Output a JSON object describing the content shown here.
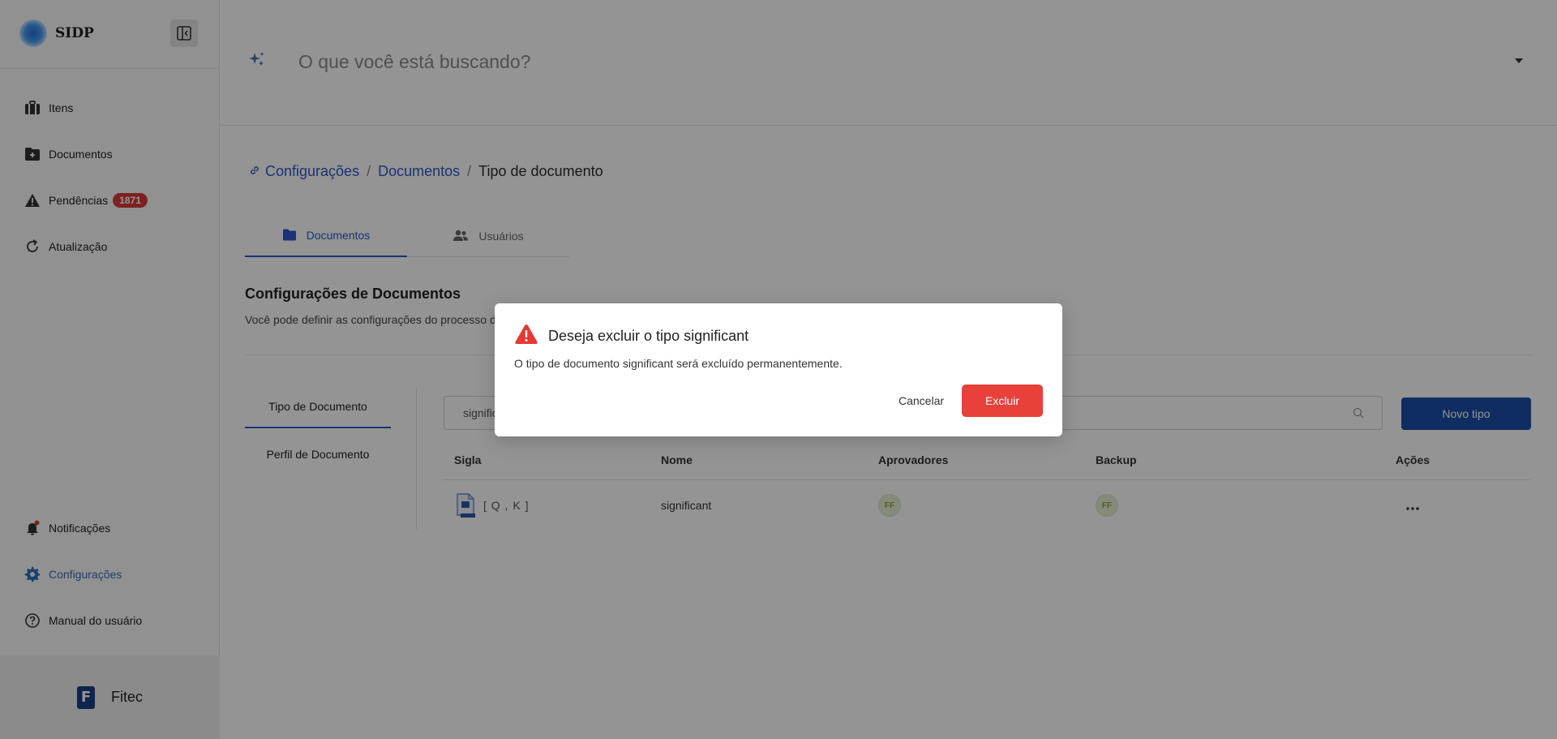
{
  "app": {
    "name": "SIDP"
  },
  "sidebar": {
    "items": [
      {
        "label": "Itens",
        "icon": "briefcase-icon"
      },
      {
        "label": "Documentos",
        "icon": "folder-plus-icon"
      },
      {
        "label": "Pendências",
        "icon": "warning-icon",
        "badge": "1871"
      },
      {
        "label": "Atualização",
        "icon": "refresh-icon"
      }
    ],
    "bottom_items": [
      {
        "label": "Notificações",
        "icon": "bell-icon"
      },
      {
        "label": "Configurações",
        "icon": "gear-icon",
        "active": true
      },
      {
        "label": "Manual do usuário",
        "icon": "help-circle-icon"
      }
    ],
    "footer": {
      "logo_letter": "F",
      "name": "Fitec"
    }
  },
  "search": {
    "placeholder": "O que você está buscando?"
  },
  "breadcrumb": {
    "items": [
      "Configurações",
      "Documentos"
    ],
    "current": "Tipo de documento",
    "separator": "/"
  },
  "tabs": [
    {
      "label": "Documentos",
      "active": true
    },
    {
      "label": "Usuários",
      "active": false
    }
  ],
  "section": {
    "title": "Configurações de Documentos",
    "description": "Você pode definir as configurações do processo d"
  },
  "subnav": [
    "Tipo de Documento",
    "Perfil de Documento"
  ],
  "filter": {
    "value": "significant"
  },
  "new_type_button": "Novo tipo",
  "table": {
    "headers": [
      "Sigla",
      "Nome",
      "Aprovadores",
      "Backup",
      "Ações"
    ],
    "rows": [
      {
        "sigla": "[ Q , K ]",
        "nome": "significant",
        "aprovadores": "FF",
        "backup": "FF"
      }
    ]
  },
  "modal": {
    "title": "Deseja excluir o tipo significant",
    "text": "O tipo de documento significant será excluído permanentemente.",
    "cancel": "Cancelar",
    "confirm": "Excluir"
  },
  "colors": {
    "primary": "#2b58c9",
    "button": "#1b4ea8",
    "danger": "#e8403a",
    "badge": "#d93a3a"
  }
}
